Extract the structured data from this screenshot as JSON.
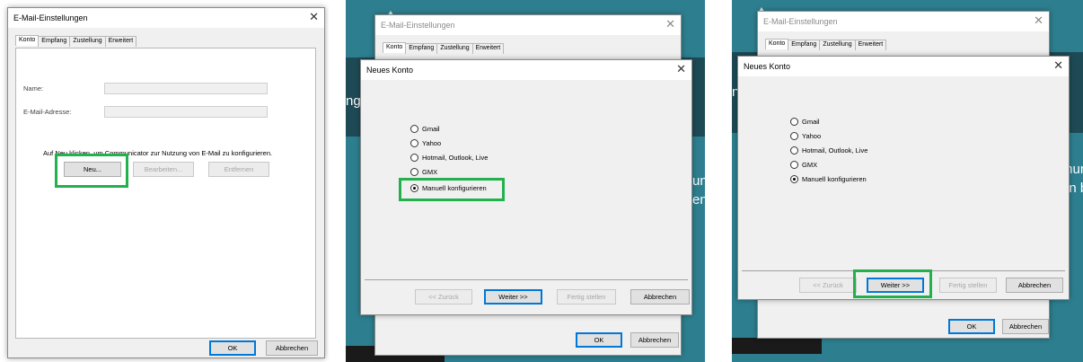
{
  "panel1": {
    "title": "E-Mail-Einstellungen",
    "close": "✕",
    "tabs": [
      "Konto",
      "Empfang",
      "Zustellung",
      "Erweitert"
    ],
    "name_label": "Name:",
    "email_label": "E-Mail-Adresse:",
    "instruction": "Auf Neu klicken, um Communicator zur Nutzung von E-Mail zu konfigurieren.",
    "new_button": "Neu...",
    "edit_button": "Bearbeiten...",
    "remove_button": "Entfernen",
    "ok_button": "OK",
    "cancel_button": "Abbrechen"
  },
  "panel2": {
    "background_title": "E-Mail-Einstellungen",
    "background_tabs": [
      "Konto",
      "Empfang",
      "Zustellung",
      "Erweitert"
    ],
    "bg_fragment_left": "ng",
    "bg_fragment_right_1": "un",
    "bg_fragment_right_2": "en b",
    "dialog_title": "Neues Konto",
    "options": [
      "Gmail",
      "Yahoo",
      "Hotmail, Outlook, Live",
      "GMX",
      "Manuell konfigurieren"
    ],
    "selected_option": "Manuell konfigurieren",
    "back_button": "<< Zurück",
    "next_button": "Weiter >>",
    "finish_button": "Fertig stellen",
    "cancel_button": "Abbrechen",
    "ok_button": "OK",
    "background_cancel_button": "Abbrechen"
  },
  "panel3": {
    "background_title": "E-Mail-Einstellungen",
    "background_tabs": [
      "Konto",
      "Empfang",
      "Zustellung",
      "Erweitert"
    ],
    "bg_fragment_left": "ng",
    "bg_fragment_right_1": "mur",
    "bg_fragment_right_2": "en b",
    "dialog_title": "Neues Konto",
    "options": [
      "Gmail",
      "Yahoo",
      "Hotmail, Outlook, Live",
      "GMX",
      "Manuell konfigurieren"
    ],
    "selected_option": "Manuell konfigurieren",
    "back_button": "<< Zurück",
    "next_button": "Weiter >>",
    "finish_button": "Fertig stellen",
    "cancel_button": "Abbrechen",
    "ok_button": "OK",
    "background_cancel_button": "Abbrechen"
  },
  "colors": {
    "highlight": "#22b14c",
    "teal_background": "#2d7f90",
    "default_button_border": "#0078d7"
  }
}
